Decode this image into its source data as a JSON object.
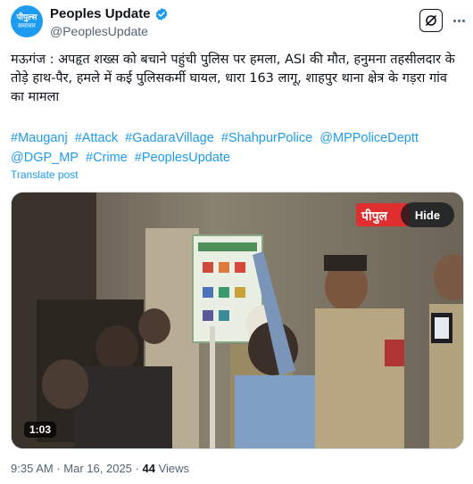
{
  "author": {
    "avatar_line1": "पीपुल्स",
    "avatar_line2": "समाचार",
    "display_name": "Peoples Update",
    "handle": "@PeoplesUpdate"
  },
  "post": {
    "text": "मऊगंज : अपहृत शख्स को बचाने पहुंची पुलिस पर हमला, ASI की मौत, हनुमना तहसीलदार के तोड़े हाथ-पैर, हमले में कई पुलिसकर्मी घायल, धारा 163 लागू, शाहपुर थाना क्षेत्र के गड़रा गांव का मामला",
    "hashtags": [
      "#Mauganj",
      "#Attack",
      "#GadaraVillage",
      "#ShahpurPolice",
      "@MPPoliceDeptt",
      "@DGP_MP",
      "#Crime",
      "#PeoplesUpdate"
    ],
    "translate_label": "Translate post"
  },
  "media": {
    "watermark": "पीपुल",
    "hide_label": "Hide",
    "duration": "1:03"
  },
  "meta": {
    "time": "9:35 AM",
    "separator": "·",
    "date": "Mar 16, 2025",
    "views_count": "44",
    "views_label": "Views"
  },
  "colors": {
    "accent": "#1d9bf0",
    "secondary_text": "#536471"
  }
}
